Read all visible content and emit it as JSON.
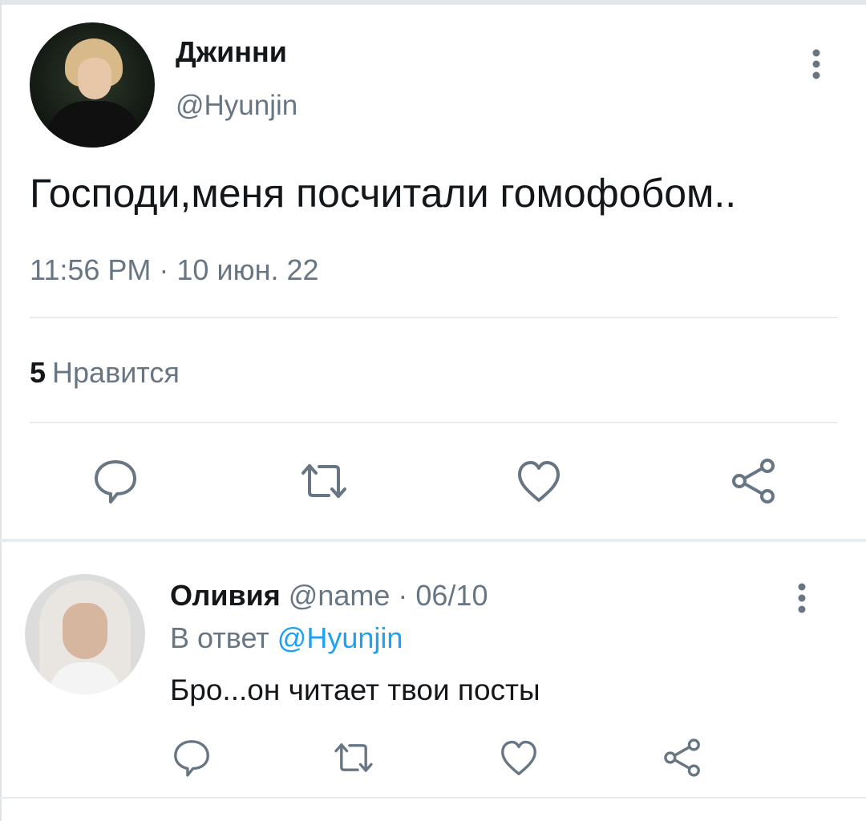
{
  "tweet": {
    "author_name": "Джинни",
    "author_handle": "@Hyunjin",
    "text": "Господи,меня посчитали гомофобом..",
    "timestamp": "11:56 PM · 10 июн. 22",
    "likes_count": "5",
    "likes_label": "Нравится"
  },
  "reply": {
    "author_name": "Оливия",
    "meta": " @name · 06/10",
    "reply_prefix": "В ответ ",
    "reply_mention": "@Hyunjin",
    "text": "Бро...он читает твои посты"
  },
  "icons": {
    "actions": [
      "reply-icon",
      "retweet-icon",
      "like-icon",
      "share-icon"
    ],
    "more": "more-vertical-icon"
  },
  "colors": {
    "text": "#14171a",
    "secondary": "#687684",
    "accent": "#1da1f2",
    "divider": "#e6ecf0"
  }
}
